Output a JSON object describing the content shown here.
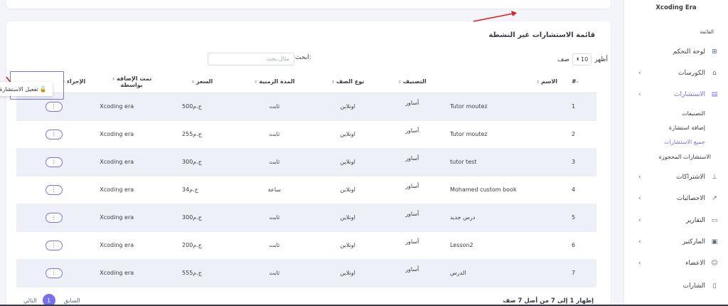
{
  "card_title": "قائمة الاستشارات غير النشطة",
  "show_label": "أظهر",
  "show_value": "10",
  "entries_label": "صف",
  "search_label": "ابحث:",
  "search_placeholder": "مثال بحث",
  "columns": {
    "num": "#",
    "name": "الاسم",
    "category": "التصنيف",
    "class_type": "نوع الصف",
    "duration": "المدة الزمنية",
    "price": "السعر",
    "added_by": "تمت الإضافة بواسطة",
    "action": "الإجراء"
  },
  "rows": [
    {
      "num": "1",
      "name": "Tutor moutez",
      "category": "أساور",
      "class_type": "اونلاين",
      "duration": "ثابت",
      "price": "500ج.م",
      "added_by": "Xcoding era"
    },
    {
      "num": "2",
      "name": "Tutor moutez",
      "category": "أساور",
      "class_type": "اونلاين",
      "duration": "ثابت",
      "price": "255ج.م",
      "added_by": "Xcoding era"
    },
    {
      "num": "3",
      "name": "tutor test",
      "category": "أساور",
      "class_type": "اونلاين",
      "duration": "ثابت",
      "price": "300ج.م",
      "added_by": "Xcoding era"
    },
    {
      "num": "4",
      "name": "Mohamed custom book",
      "category": "أساور",
      "class_type": "اونلاين",
      "duration": "ساعة",
      "price": "34ج.م",
      "added_by": "Xcoding era"
    },
    {
      "num": "5",
      "name": "درس جديد",
      "category": "أساور",
      "class_type": "اونلاين",
      "duration": "ثابت",
      "price": "300ج.م",
      "added_by": "Xcoding era"
    },
    {
      "num": "6",
      "name": "Lesson2",
      "category": "أساور",
      "class_type": "اونلاين",
      "duration": "ثابت",
      "price": "200ج.م",
      "added_by": "Xcoding era"
    },
    {
      "num": "7",
      "name": "الدرس",
      "category": "أساور",
      "class_type": "اونلاين",
      "duration": "ثابت",
      "price": "555ج.م",
      "added_by": "Xcoding era"
    }
  ],
  "action_menu_label": "⋮",
  "tooltip_label": "تفعيل الاستشارة",
  "footer_info": "إظهار 1 إلى 7 من أصل 7 صف",
  "pager": {
    "prev": "السابق",
    "page": "1",
    "next": "التالي"
  },
  "sidebar": {
    "brand": "Xcoding Era",
    "menu_header": "القائمة",
    "items": [
      {
        "label": "لوحة التحكم",
        "icon": "⊞"
      },
      {
        "label": "الكورسات",
        "icon": "⌂"
      },
      {
        "label": "الاستشارات",
        "icon": "▤"
      },
      {
        "label": "الاشتراكات",
        "icon": "⊥"
      },
      {
        "label": "الاحصائيات",
        "icon": "↗"
      },
      {
        "label": "التقارير",
        "icon": "▭"
      },
      {
        "label": "الماركتير",
        "icon": "▣"
      },
      {
        "label": "الاعضاء",
        "icon": "☺"
      },
      {
        "label": "الشارات",
        "icon": "▯"
      }
    ],
    "sub_items": [
      "التصنيفات",
      "إضافة استشارة",
      "جميع الاستشارات",
      "الاستشارات المحجوزة"
    ],
    "chevron": "›"
  },
  "colors": {
    "accent": "#7a6ff0",
    "annotation": "#e11d1d"
  }
}
